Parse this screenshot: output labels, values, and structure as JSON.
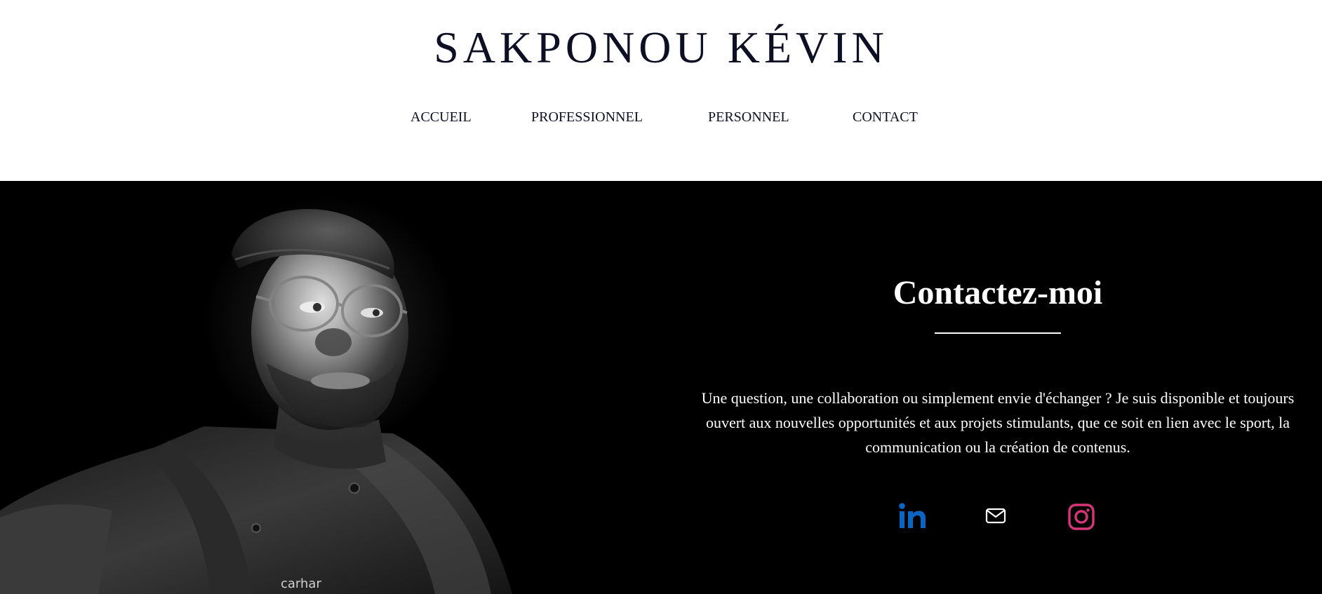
{
  "header": {
    "site_title": "SAKPONOU KÉVIN",
    "nav": [
      {
        "label": "ACCUEIL"
      },
      {
        "label": "PROFESSIONNEL"
      },
      {
        "label": "PERSONNEL"
      },
      {
        "label": "CONTACT"
      }
    ]
  },
  "hero": {
    "photo_alt": "Portrait noir et blanc",
    "jacket_logo_text": "carhar"
  },
  "contact": {
    "title": "Contactez-moi",
    "text": "Une question, une collaboration ou simplement envie d'échanger ? Je suis disponible et toujours ouvert aux nouvelles opportunités et aux projets stimulants, que ce soit en lien avec le sport, la communication ou la création de contenus.",
    "socials": [
      {
        "name": "linkedin",
        "icon": "linkedin-icon",
        "color": "#0a66c2"
      },
      {
        "name": "email",
        "icon": "mail-icon",
        "color": "#ffffff"
      },
      {
        "name": "instagram",
        "icon": "instagram-icon",
        "color": "#e1306c"
      }
    ]
  },
  "colors": {
    "text_dark": "#0d0f24",
    "section_bg": "#000000",
    "linkedin": "#0a66c2",
    "instagram": "#d6357a"
  }
}
